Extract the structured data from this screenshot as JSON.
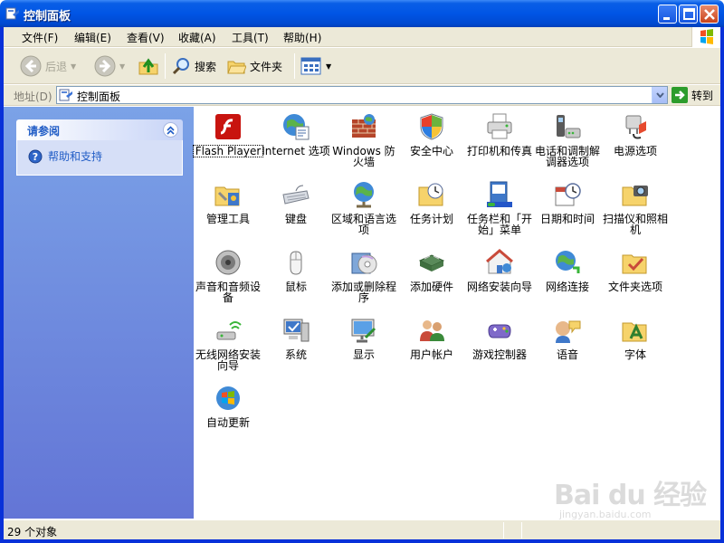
{
  "window": {
    "title": "控制面板",
    "buttons": [
      "minimize",
      "maximize",
      "close"
    ]
  },
  "menubar": {
    "items": [
      "文件(F)",
      "编辑(E)",
      "查看(V)",
      "收藏(A)",
      "工具(T)",
      "帮助(H)"
    ]
  },
  "toolbar": {
    "back_label": "后退",
    "search_label": "搜索",
    "folders_label": "文件夹"
  },
  "address": {
    "label": "地址(D)",
    "value": "控制面板",
    "go_label": "转到"
  },
  "taskpane": {
    "panel_title": "请参阅",
    "help_link": "帮助和支持"
  },
  "items": [
    {
      "label": "Flash Player",
      "icon": "flash-player-icon"
    },
    {
      "label": "Internet 选项",
      "icon": "internet-options-icon"
    },
    {
      "label": "Windows 防火墙",
      "icon": "firewall-icon"
    },
    {
      "label": "安全中心",
      "icon": "security-center-icon"
    },
    {
      "label": "打印机和传真",
      "icon": "printers-icon"
    },
    {
      "label": "电话和调制解调器选项",
      "icon": "phone-modem-icon"
    },
    {
      "label": "电源选项",
      "icon": "power-options-icon"
    },
    {
      "label": "管理工具",
      "icon": "admin-tools-icon"
    },
    {
      "label": "键盘",
      "icon": "keyboard-icon"
    },
    {
      "label": "区域和语言选项",
      "icon": "regional-options-icon"
    },
    {
      "label": "任务计划",
      "icon": "scheduled-tasks-icon"
    },
    {
      "label": "任务栏和「开始」菜单",
      "icon": "taskbar-start-icon"
    },
    {
      "label": "日期和时间",
      "icon": "date-time-icon"
    },
    {
      "label": "扫描仪和照相机",
      "icon": "scanners-cameras-icon"
    },
    {
      "label": "声音和音频设备",
      "icon": "sounds-audio-icon"
    },
    {
      "label": "鼠标",
      "icon": "mouse-icon"
    },
    {
      "label": "添加或删除程序",
      "icon": "add-remove-programs-icon"
    },
    {
      "label": "添加硬件",
      "icon": "add-hardware-icon"
    },
    {
      "label": "网络安装向导",
      "icon": "network-setup-icon"
    },
    {
      "label": "网络连接",
      "icon": "network-connections-icon"
    },
    {
      "label": "文件夹选项",
      "icon": "folder-options-icon"
    },
    {
      "label": "无线网络安装向导",
      "icon": "wireless-setup-icon"
    },
    {
      "label": "系统",
      "icon": "system-icon"
    },
    {
      "label": "显示",
      "icon": "display-icon"
    },
    {
      "label": "用户帐户",
      "icon": "user-accounts-icon"
    },
    {
      "label": "游戏控制器",
      "icon": "game-controllers-icon"
    },
    {
      "label": "语音",
      "icon": "speech-icon"
    },
    {
      "label": "字体",
      "icon": "fonts-icon"
    },
    {
      "label": "自动更新",
      "icon": "automatic-updates-icon"
    }
  ],
  "statusbar": {
    "text": "29 个对象"
  },
  "watermark": {
    "logo": "Bai du 经验",
    "url": "jingyan.baidu.com"
  },
  "colors": {
    "titlebar": "#0055e5",
    "chrome": "#ece9d8",
    "taskpane_top": "#7ba2e7",
    "taskpane_bottom": "#6375d6",
    "link": "#215dc6"
  }
}
